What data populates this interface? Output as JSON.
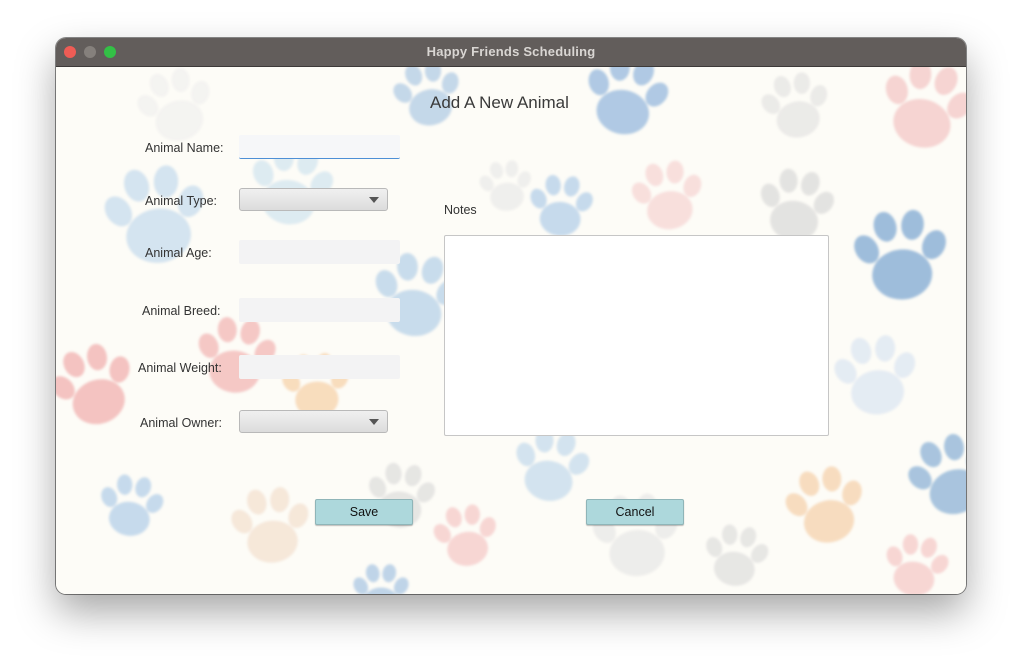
{
  "window": {
    "title": "Happy Friends Scheduling"
  },
  "form": {
    "heading": "Add A New Animal",
    "name_label": "Animal Name:",
    "name_value": "",
    "type_label": "Animal Type:",
    "type_value": "",
    "age_label": "Animal Age:",
    "age_value": "",
    "breed_label": "Animal Breed:",
    "breed_value": "",
    "weight_label": "Animal Weight:",
    "weight_value": "",
    "owner_label": "Animal Owner:",
    "owner_value": "",
    "notes_label": "Notes",
    "notes_value": ""
  },
  "buttons": {
    "save": "Save",
    "cancel": "Cancel"
  },
  "colors": {
    "titlebar": "#625d5b",
    "button": "#add8dc",
    "focus_underline": "#4d8fd6",
    "paw_palette": [
      "#a9c8e6",
      "#f2b3b3",
      "#f4cfa3",
      "#c9c9c9",
      "#b8d3ea"
    ]
  }
}
